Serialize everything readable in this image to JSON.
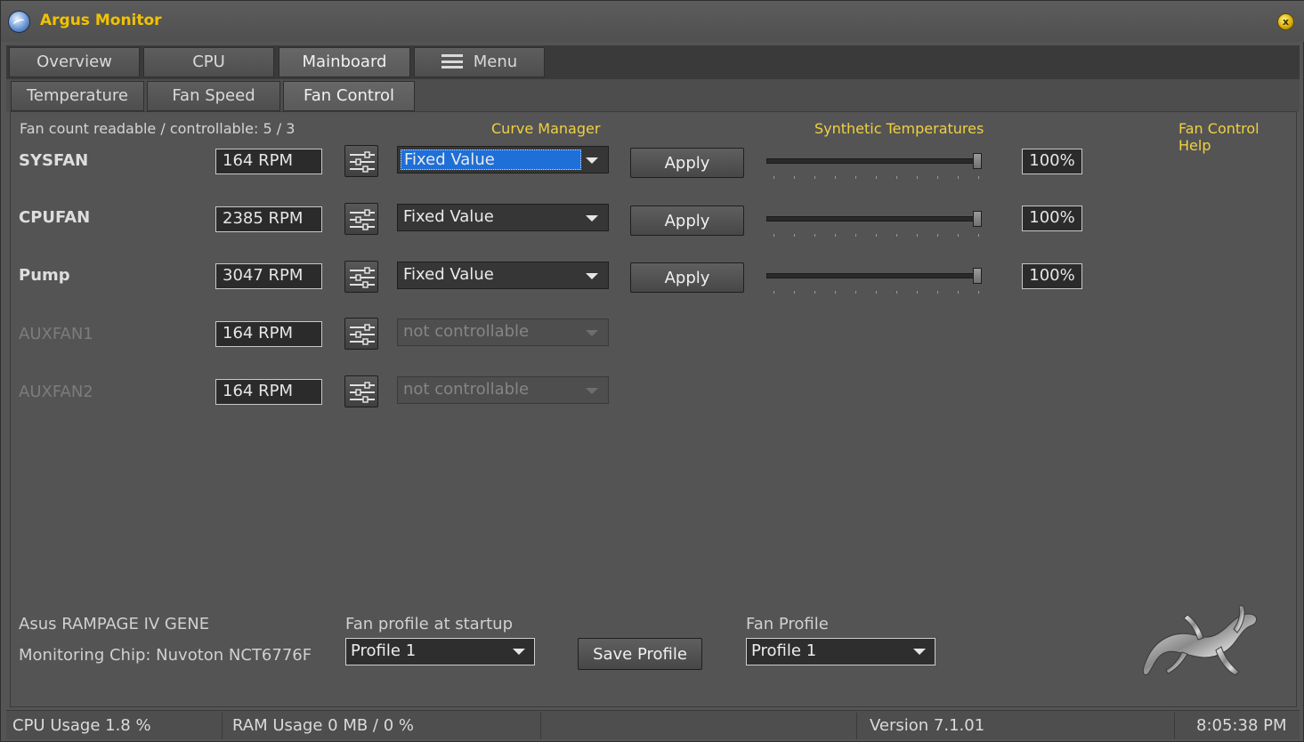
{
  "window": {
    "title": "Argus Monitor",
    "app_icon": "argus-logo-icon",
    "close_icon": "close-icon"
  },
  "main_tabs": [
    {
      "label": "Overview"
    },
    {
      "label": "CPU"
    },
    {
      "label": "Mainboard",
      "active": true
    },
    {
      "label": "Menu",
      "icon": "hamburger-menu-icon"
    }
  ],
  "sub_tabs": [
    {
      "label": "Temperature"
    },
    {
      "label": "Fan Speed"
    },
    {
      "label": "Fan Control",
      "active": true
    }
  ],
  "header": {
    "fan_count": "Fan count readable / controllable: 5 / 3",
    "curve_manager": "Curve Manager",
    "synthetic_temperatures": "Synthetic Temperatures",
    "help": "Fan Control Help"
  },
  "fans": [
    {
      "name": "SYSFAN",
      "rpm": "164 RPM",
      "mode": "Fixed Value",
      "apply": "Apply",
      "percent": "100%",
      "level": 1.0,
      "controllable": true
    },
    {
      "name": "CPUFAN",
      "rpm": "2385 RPM",
      "mode": "Fixed Value",
      "apply": "Apply",
      "percent": "100%",
      "level": 1.0,
      "controllable": true
    },
    {
      "name": "Pump",
      "rpm": "3047 RPM",
      "mode": "Fixed Value",
      "apply": "Apply",
      "percent": "100%",
      "level": 1.0,
      "controllable": true
    },
    {
      "name": "AUXFAN1",
      "rpm": "164 RPM",
      "mode": "not controllable",
      "controllable": false
    },
    {
      "name": "AUXFAN2",
      "rpm": "164 RPM",
      "mode": "not controllable",
      "controllable": false
    }
  ],
  "footer": {
    "board": "Asus RAMPAGE IV GENE",
    "chip": "Monitoring Chip: Nuvoton NCT6776F",
    "startup_label": "Fan profile at startup",
    "startup_value": "Profile 1",
    "save_label": "Save Profile",
    "profile_label": "Fan Profile",
    "profile_value": "Profile 1",
    "logo": "gecko-logo-icon"
  },
  "status": {
    "cpu": "CPU Usage 1.8 %",
    "ram": "RAM Usage 0 MB / 0 %",
    "version": "Version 7.1.01",
    "time": "8:05:38 PM"
  },
  "colors": {
    "accent_yellow": "#f0d040",
    "title_yellow": "#f2c200",
    "selection_blue": "#1e6fd8",
    "background": "#545454"
  }
}
